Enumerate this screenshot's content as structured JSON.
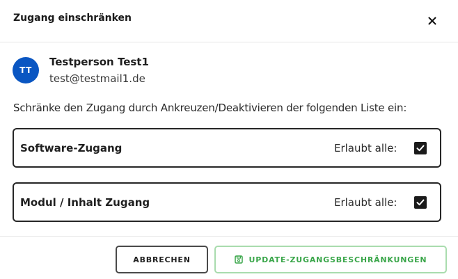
{
  "dialog": {
    "title": "Zugang einschränken",
    "close_icon": "close-icon"
  },
  "user": {
    "initials": "TT",
    "name": "Testperson Test1",
    "email": "test@testmail1.de",
    "avatar_color": "#0a56c2"
  },
  "instruction": "Schränke den Zugang durch Ankreuzen/Deaktivieren der folgenden Liste ein:",
  "permissions": [
    {
      "label": "Software-Zugang",
      "allow_label": "Erlaubt alle:",
      "checked": true
    },
    {
      "label": "Modul / Inhalt Zugang",
      "allow_label": "Erlaubt alle:",
      "checked": true
    }
  ],
  "footer": {
    "cancel_label": "ABBRECHEN",
    "update_label": "UPDATE-ZUGANGSBESCHRÄNKUNGEN",
    "update_icon": "save-icon",
    "update_color": "#3aa64a"
  }
}
